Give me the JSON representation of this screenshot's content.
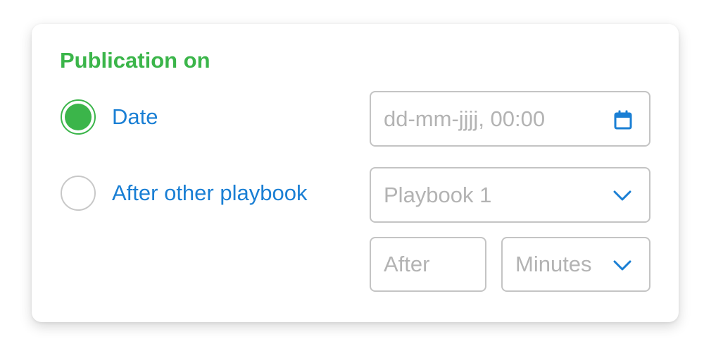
{
  "title": "Publication on",
  "options": [
    {
      "label": "Date",
      "checked": true
    },
    {
      "label": "After other playbook",
      "checked": false
    }
  ],
  "date_field": {
    "placeholder": "dd-mm-jjjj, 00:00",
    "value": "",
    "icon": "calendar-icon"
  },
  "playbook_select": {
    "value": "Playbook 1",
    "icon": "chevron-down-icon"
  },
  "after_field": {
    "placeholder": "After",
    "value": ""
  },
  "unit_select": {
    "value": "Minutes",
    "icon": "chevron-down-icon"
  },
  "colors": {
    "title": "#3bb54a",
    "radio_checked": "#3bb54a",
    "radio_border": "#c8c8c8",
    "label": "#1a7fd4",
    "icon": "#1a7fd4",
    "placeholder": "#b3b3b3",
    "field_border": "#c4c4c4"
  }
}
